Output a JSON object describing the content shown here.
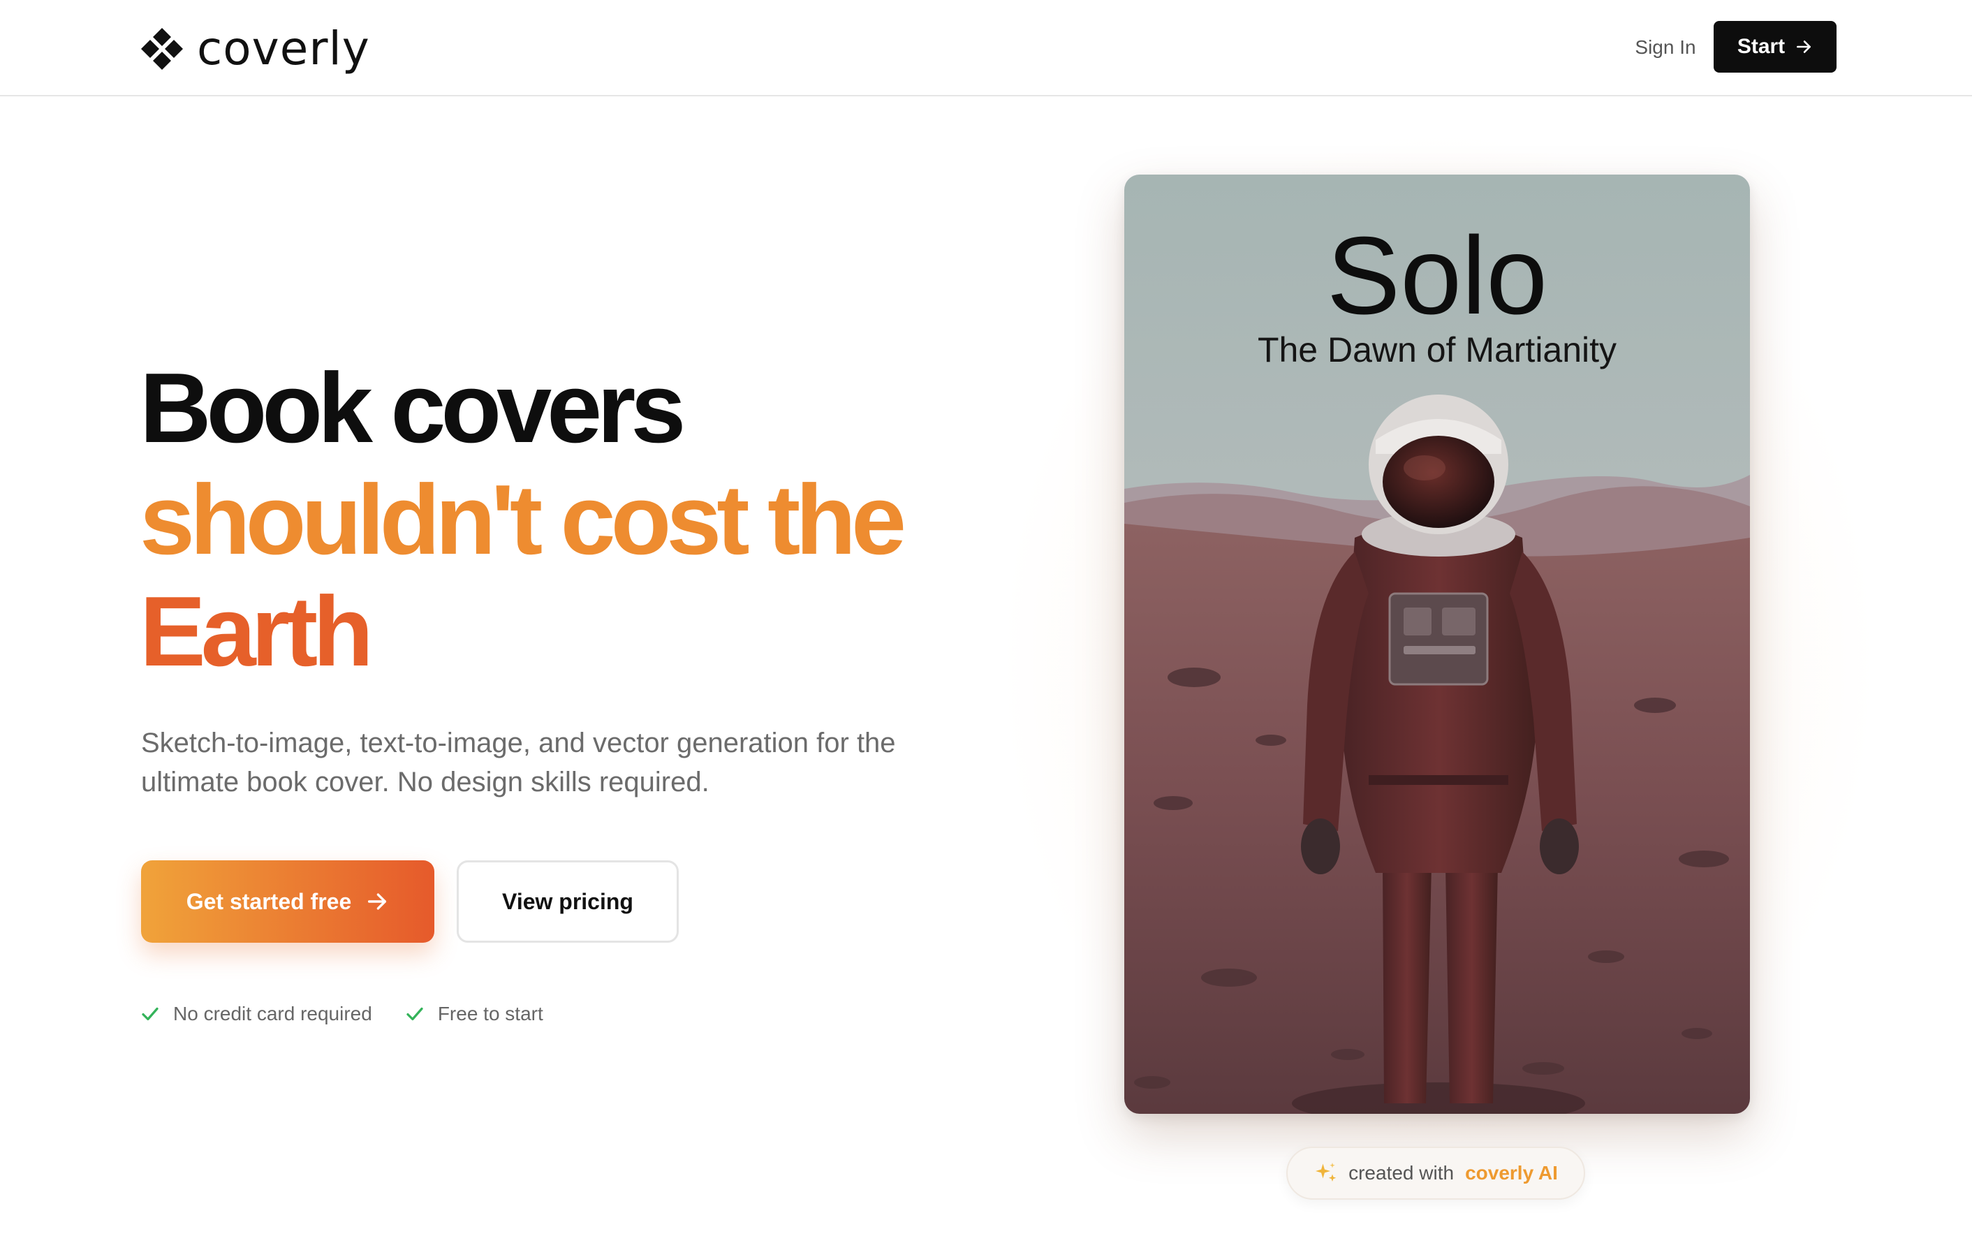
{
  "header": {
    "brand": "coverly",
    "sign_in": "Sign In",
    "start": "Start"
  },
  "hero": {
    "headline_line1": "Book covers",
    "headline_line2": "shouldn't cost the",
    "headline_line3": "Earth",
    "subtitle": "Sketch-to-image, text-to-image, and vector generation for the ultimate book cover. No design skills required.",
    "cta_primary": "Get started free",
    "cta_secondary": "View pricing",
    "checks": [
      "No credit card required",
      "Free to start"
    ]
  },
  "cover": {
    "title": "Solo",
    "subtitle": "The Dawn of Martianity"
  },
  "badge": {
    "prefix": "created with",
    "brand": "coverly AI"
  },
  "colors": {
    "accent_orange": "#ee8c30",
    "accent_deep_orange": "#e6602a",
    "check_green": "#34b35a",
    "primary_dark": "#0d0d0d"
  },
  "icons": {
    "logo": "logo-mark-icon",
    "start_arrow": "arrow-right-icon",
    "cta_arrow": "arrow-right-icon",
    "check": "check-icon",
    "badge": "sparkle-icon"
  }
}
